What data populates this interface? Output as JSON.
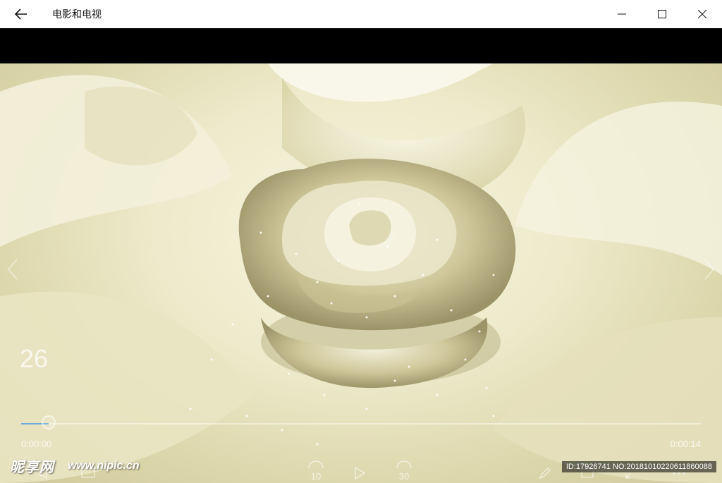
{
  "window": {
    "title": "电影和电视",
    "back_icon": "back-arrow-icon",
    "minimize_icon": "minimize-icon",
    "maximize_icon": "maximize-icon",
    "close_icon": "close-icon"
  },
  "player": {
    "chapter_number": "26",
    "time_current": "0:00:00",
    "time_total": "0:00:14",
    "progress_fraction": 0.04,
    "skip_back_label": "10",
    "skip_forward_label": "30",
    "prev_icon": "chevron-left-icon",
    "next_icon": "chevron-right-icon",
    "play_icon": "play-icon",
    "accent_color": "#6fa8dc"
  },
  "watermark": {
    "logo": "昵享网",
    "url": "www.nipic.cn",
    "id_text": "ID:17926741 NO:20181010220611860088"
  }
}
